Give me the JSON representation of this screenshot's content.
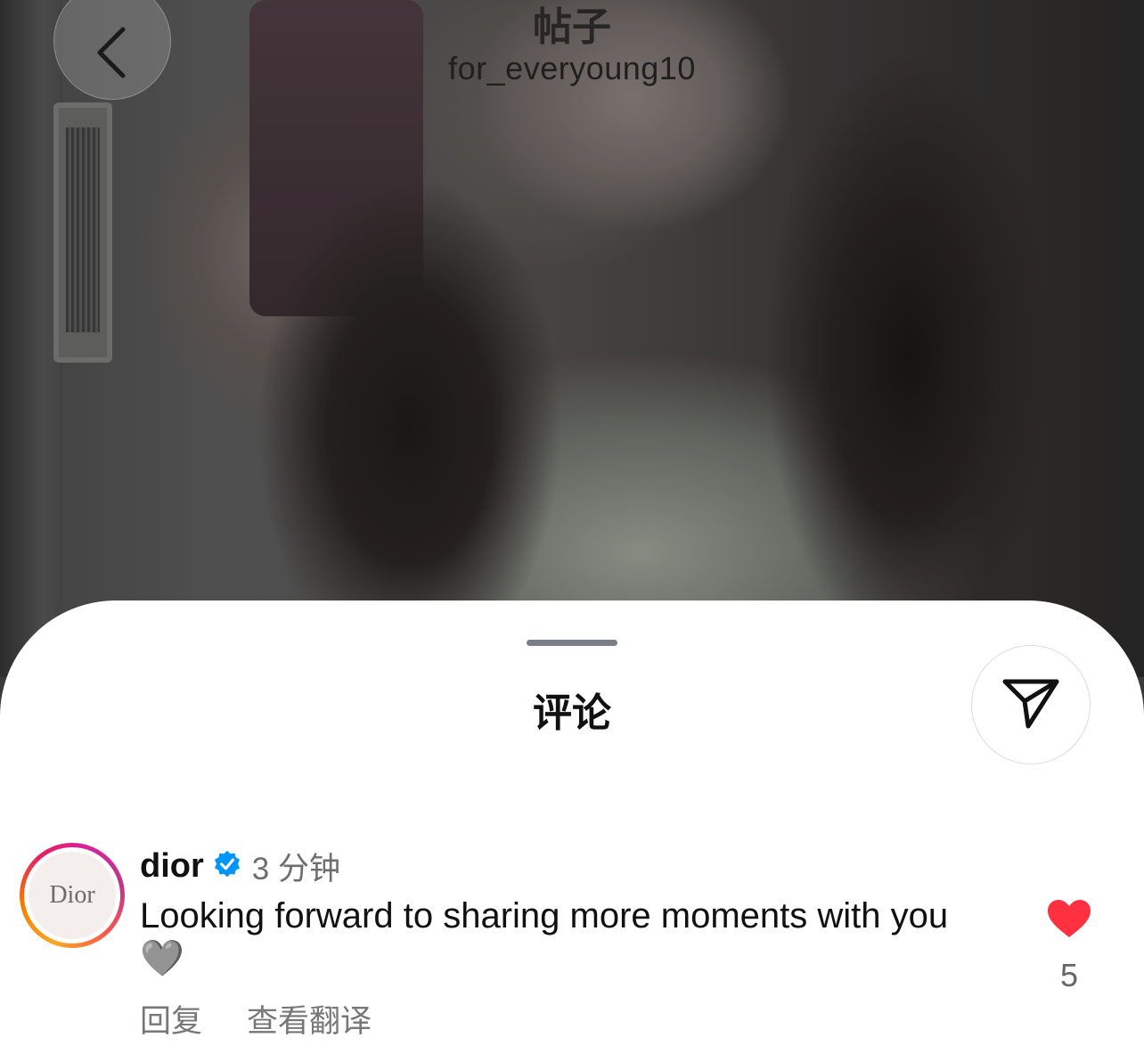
{
  "header": {
    "title": "帖子",
    "subtitle": "for_everyoung10",
    "back_icon": "chevron-left-icon"
  },
  "sheet": {
    "title": "评论",
    "filter_icon": "paper-plane-icon"
  },
  "comment": {
    "avatar_text": "Dior",
    "username": "dior",
    "verified": true,
    "time": "3 分钟",
    "text": "Looking forward to sharing more moments with you 🩶",
    "actions": {
      "reply": "回复",
      "translate": "查看翻译"
    },
    "likes": "5",
    "liked": true
  },
  "colors": {
    "like_red": "#ff3040",
    "verified_blue": "#0095f6"
  }
}
